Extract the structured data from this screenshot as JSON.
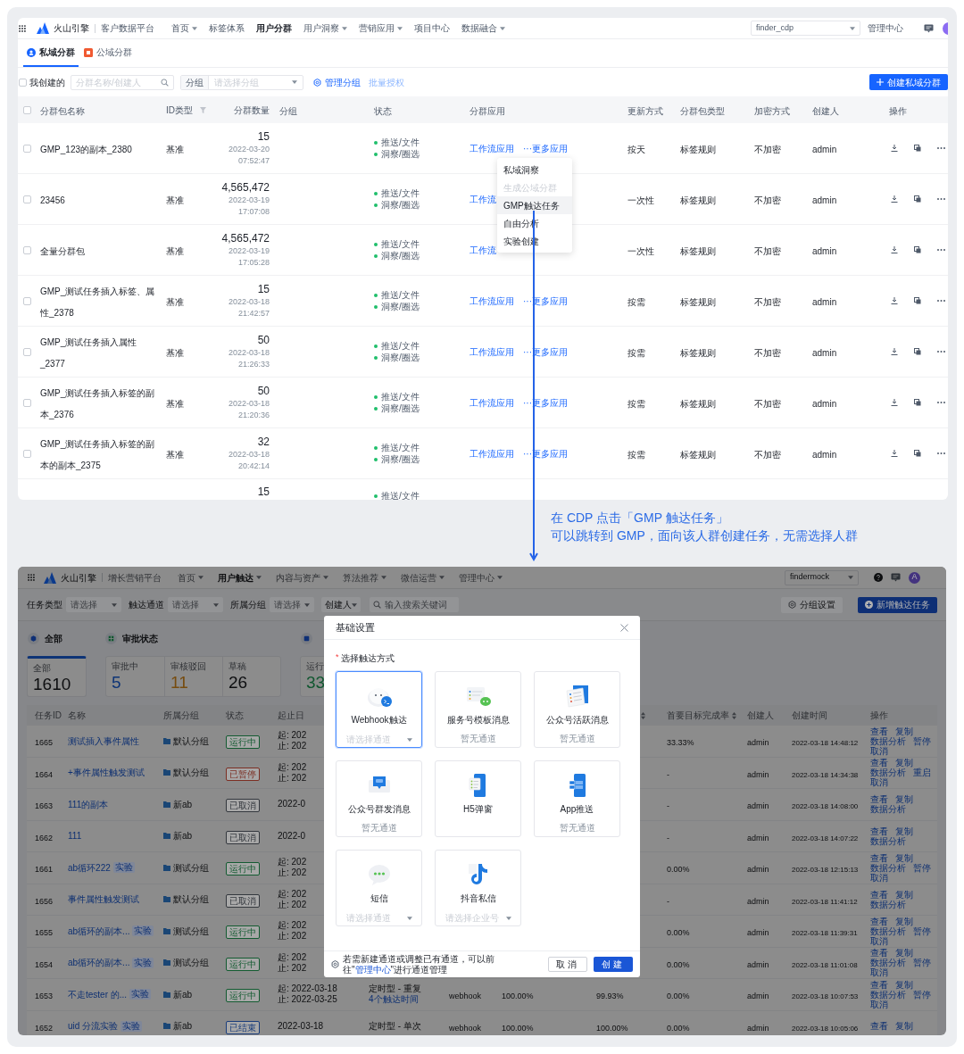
{
  "cdp_screen": {
    "brand": {
      "name": "火山引擎",
      "product": "客户数据平台"
    },
    "nav": [
      {
        "label": "首页",
        "dropdown": true,
        "selected": false
      },
      {
        "label": "标签体系",
        "dropdown": false,
        "selected": false
      },
      {
        "label": "用户分群",
        "dropdown": false,
        "selected": true
      },
      {
        "label": "用户洞察",
        "dropdown": true,
        "selected": false
      },
      {
        "label": "营销应用",
        "dropdown": true,
        "selected": false
      },
      {
        "label": "项目中心",
        "dropdown": false,
        "selected": false
      },
      {
        "label": "数据融合",
        "dropdown": true,
        "selected": false
      }
    ],
    "project": "finder_cdp",
    "admin_link": "管理中心",
    "tabs": [
      {
        "label": "私域分群",
        "selected": true
      },
      {
        "label": "公域分群",
        "selected": false
      }
    ],
    "mine_filter": {
      "label": "我创建的",
      "checked": false
    },
    "search": {
      "placeholder": "分群名称/创建人"
    },
    "group_filter": {
      "label": "分组",
      "placeholder": "请选择分组"
    },
    "manage_groups": "管理分组",
    "batch_authorize": "批量授权",
    "create_button": "创建私域分群",
    "table": {
      "select_all": {
        "checked": false
      },
      "columns": [
        "分群包名称",
        "ID类型",
        "分群数量",
        "分组",
        "状态",
        "分群应用",
        "更新方式",
        "分群包类型",
        "加密方式",
        "创建人",
        "操作"
      ],
      "rows": [
        {
          "checked": false,
          "name": "GMP_123的副本_2380",
          "id_type": "基准",
          "count": "15",
          "date": "2022-03-20",
          "time": "07:52:47",
          "states": [
            "推送/文件",
            "洞察/圈选"
          ],
          "apps": [
            "工作流应用",
            "···更多应用"
          ],
          "update": "按天",
          "type": "标签规则",
          "encryption": "不加密",
          "creator": "admin"
        },
        {
          "checked": false,
          "name": "23456",
          "id_type": "基准",
          "count": "4,565,472",
          "date": "2022-03-19",
          "time": "17:07:08",
          "states": [
            "推送/文件",
            "洞察/圈选"
          ],
          "apps": [
            "工作流"
          ],
          "update": "一次性",
          "type": "标签规则",
          "encryption": "不加密",
          "creator": "admin"
        },
        {
          "checked": false,
          "name": "全量分群包",
          "id_type": "基准",
          "count": "4,565,472",
          "date": "2022-03-19",
          "time": "17:05:28",
          "states": [
            "推送/文件",
            "洞察/圈选"
          ],
          "apps": [
            "工作流"
          ],
          "update": "一次性",
          "type": "标签规则",
          "encryption": "不加密",
          "creator": "admin"
        },
        {
          "checked": false,
          "name": "GMP_测试任务插入标签、属性_2378",
          "id_type": "基准",
          "count": "15",
          "date": "2022-03-18",
          "time": "21:42:57",
          "states": [
            "推送/文件",
            "洞察/圈选"
          ],
          "apps": [
            "工作流应用",
            "···更多应用"
          ],
          "update": "按需",
          "type": "标签规则",
          "encryption": "不加密",
          "creator": "admin"
        },
        {
          "checked": false,
          "name": "GMP_测试任务插入属性_2377",
          "id_type": "基准",
          "count": "50",
          "date": "2022-03-18",
          "time": "21:26:33",
          "states": [
            "推送/文件",
            "洞察/圈选"
          ],
          "apps": [
            "工作流应用",
            "···更多应用"
          ],
          "update": "按需",
          "type": "标签规则",
          "encryption": "不加密",
          "creator": "admin"
        },
        {
          "checked": false,
          "name": "GMP_测试任务插入标签的副本_2376",
          "id_type": "基准",
          "count": "50",
          "date": "2022-03-18",
          "time": "21:20:36",
          "states": [
            "推送/文件",
            "洞察/圈选"
          ],
          "apps": [
            "工作流应用",
            "···更多应用"
          ],
          "update": "按需",
          "type": "标签规则",
          "encryption": "不加密",
          "creator": "admin"
        },
        {
          "checked": false,
          "name": "GMP_测试任务插入标签的副本的副本_2375",
          "id_type": "基准",
          "count": "32",
          "date": "2022-03-18",
          "time": "20:42:14",
          "states": [
            "推送/文件",
            "洞察/圈选"
          ],
          "apps": [
            "工作流应用",
            "···更多应用"
          ],
          "update": "按需",
          "type": "标签规则",
          "encryption": "不加密",
          "creator": "admin"
        },
        {
          "count": "15",
          "states": [
            "推送/文件"
          ]
        }
      ]
    },
    "more_menu": [
      {
        "label": "私域洞察",
        "disabled": false,
        "selected": false
      },
      {
        "label": "生成公域分群",
        "disabled": true,
        "selected": false
      },
      {
        "label": "GMP触达任务",
        "disabled": false,
        "selected": true
      },
      {
        "label": "自由分析",
        "disabled": false,
        "selected": false
      },
      {
        "label": "实验创建",
        "disabled": false,
        "selected": false
      }
    ]
  },
  "annotation": [
    "在 CDP 点击「GMP 触达任务」",
    "可以跳转到 GMP，面向该人群创建任务，无需选择人群"
  ],
  "gmp_screen": {
    "brand": {
      "name": "火山引擎",
      "product": "增长营销平台"
    },
    "nav": [
      {
        "label": "首页",
        "dropdown": true,
        "selected": false
      },
      {
        "label": "用户触达",
        "dropdown": true,
        "selected": true
      },
      {
        "label": "内容与资产",
        "dropdown": true,
        "selected": false
      },
      {
        "label": "算法推荐",
        "dropdown": true,
        "selected": false
      },
      {
        "label": "微信运营",
        "dropdown": true,
        "selected": false
      },
      {
        "label": "管理中心",
        "dropdown": true,
        "selected": false
      }
    ],
    "project": "findermock",
    "avatar": "A",
    "filters": [
      {
        "label": "任务类型",
        "placeholder": "请选择"
      },
      {
        "label": "触达通道",
        "placeholder": "请选择"
      },
      {
        "label": "所属分组",
        "placeholder": "请选择"
      }
    ],
    "creator_filter": "创建人",
    "search": {
      "placeholder": "输入搜索关键词"
    },
    "group_settings": "分组设置",
    "create_button": "新增触达任务",
    "categories": [
      "全部",
      "审批状态"
    ],
    "stat_groups": [
      {
        "selected": true,
        "items": [
          {
            "label": "全部",
            "value": "1610",
            "color": "#0d0e10"
          }
        ]
      },
      {
        "selected": false,
        "items": [
          {
            "label": "审批中",
            "value": "5",
            "color": "#0e3476"
          },
          {
            "label": "审核驳回",
            "value": "11",
            "color": "#774c0f"
          },
          {
            "label": "草稿",
            "value": "26",
            "color": "#0d0e10"
          }
        ]
      },
      {
        "selected": false,
        "items": [
          {
            "label": "运行",
            "value": "33",
            "color": "#115730"
          }
        ]
      }
    ],
    "table": {
      "columns": [
        {
          "label": "任务ID"
        },
        {
          "label": "名称"
        },
        {
          "label": "所属分组"
        },
        {
          "label": "状态"
        },
        {
          "label": "起止日"
        },
        {
          "sortable": true
        },
        {
          "label": "首要目标完成率",
          "sortable": true
        },
        {
          "label": "创建人"
        },
        {
          "label": "创建时间"
        },
        {
          "label": "操作"
        }
      ],
      "rows": [
        {
          "id": "1665",
          "name": "测试插入事件属性",
          "group": "默认分组",
          "status": {
            "label": "运行中",
            "color": "#135b31"
          },
          "dates": [
            "起: 202",
            "止: 202"
          ],
          "goal_rate": "33.33%",
          "creator": "admin",
          "created": "2022-03-18 14:48:12",
          "actions": [
            "查看",
            "复制",
            "数据分析",
            "暂停",
            "取消"
          ]
        },
        {
          "id": "1664",
          "name": "+事件属性触发测试",
          "group": "默认分组",
          "status": {
            "label": "已暂停",
            "color": "#7b2e23"
          },
          "dates": [
            "起: 202",
            "止: 202"
          ],
          "goal_rate": "-",
          "creator": "admin",
          "created": "2022-03-18 14:34:38",
          "actions": [
            "查看",
            "复制",
            "数据分析",
            "重启",
            "取消"
          ]
        },
        {
          "id": "1663",
          "name": "111的副本",
          "group": "新ab",
          "status": {
            "label": "已取消",
            "color": "#33373d"
          },
          "dates": [
            "2022-0"
          ],
          "goal_rate": "-",
          "creator": "admin",
          "created": "2022-03-18 14:08:00",
          "actions": [
            "查看",
            "复制",
            "数据分析"
          ]
        },
        {
          "id": "1662",
          "name": "111",
          "group": "新ab",
          "status": {
            "label": "已取消",
            "color": "#33373d"
          },
          "dates": [
            "2022-0"
          ],
          "goal_rate": "-",
          "creator": "admin",
          "created": "2022-03-18 14:07:22",
          "actions": [
            "查看",
            "复制",
            "数据分析"
          ]
        },
        {
          "id": "1661",
          "name": "ab循环222",
          "badge": "实验",
          "group": "测试分组",
          "status": {
            "label": "运行中",
            "color": "#135b31"
          },
          "dates": [
            "起: 202",
            "止: 202"
          ],
          "goal_rate": "0.00%",
          "creator": "admin",
          "created": "2022-03-18 12:15:13",
          "actions": [
            "查看",
            "复制",
            "数据分析",
            "暂停",
            "取消"
          ]
        },
        {
          "id": "1656",
          "name": "事件属性触发测试",
          "group": "默认分组",
          "status": {
            "label": "已取消",
            "color": "#33373d"
          },
          "dates": [
            "起: 202",
            "止: 202"
          ],
          "goal_rate": "-",
          "creator": "admin",
          "created": "2022-03-18 11:41:12",
          "actions": [
            "查看",
            "复制",
            "数据分析"
          ]
        },
        {
          "id": "1655",
          "name": "ab循环的副本...",
          "badge": "实验",
          "group": "测试分组",
          "status": {
            "label": "运行中",
            "color": "#135b31"
          },
          "dates": [
            "起: 202",
            "止: 202"
          ],
          "goal_rate": "0.00%",
          "creator": "admin",
          "created": "2022-03-18 11:39:31",
          "actions": [
            "查看",
            "复制",
            "数据分析",
            "暂停",
            "取消"
          ]
        },
        {
          "id": "1654",
          "name": "ab循环的副本...",
          "badge": "实验",
          "group": "测试分组",
          "status": {
            "label": "运行中",
            "color": "#135b31"
          },
          "dates": [
            "起: 202",
            "止: 202"
          ],
          "goal_rate": "0.00%",
          "creator": "admin",
          "created": "2022-03-18 11:01:08",
          "actions": [
            "查看",
            "复制",
            "数据分析",
            "暂停",
            "取消"
          ]
        },
        {
          "id": "1653",
          "name": "不走tester 的...",
          "badge": "实验",
          "group": "新ab",
          "status": {
            "label": "运行中",
            "color": "#135b31"
          },
          "dates": [
            "起: 2022-03-18",
            "止: 2022-03-25"
          ],
          "schedule": [
            {
              "text": "定时型 - 重复",
              "kind": "plain"
            },
            {
              "text": "4个触达时间",
              "kind": "link"
            }
          ],
          "channel": "webhook",
          "metric_1": "100.00%",
          "metric_2": "99.93%",
          "goal_rate": "0.00%",
          "creator": "admin",
          "created": "2022-03-18 10:07:53",
          "actions": [
            "查看",
            "复制",
            "数据分析",
            "暂停",
            "取消"
          ]
        },
        {
          "id": "1652",
          "name": "uid 分流实验",
          "badge": "实验",
          "group": "新ab",
          "status": {
            "label": "已结束",
            "color": "#1a3d7b"
          },
          "dates": [
            "2022-03-18"
          ],
          "schedule": [
            {
              "text": "定时型 - 单次",
              "kind": "plain"
            }
          ],
          "channel": "webhook",
          "metric_1": "100.00%",
          "metric_2": "100.00%",
          "goal_rate": "0.00%",
          "creator": "admin",
          "created": "2022-03-18 10:05:06",
          "actions": [
            "查看",
            "复制"
          ]
        }
      ]
    },
    "modal": {
      "title": "基础设置",
      "required_mark": "*",
      "label": "选择触达方式",
      "channels": [
        {
          "name": "Webhook触达",
          "kind": "select",
          "placeholder": "请选择通道",
          "selected": true
        },
        {
          "name": "服务号模板消息",
          "kind": "note",
          "note": "暂无通道",
          "selected": false
        },
        {
          "name": "公众号活跃消息",
          "kind": "note",
          "note": "暂无通道",
          "selected": false
        },
        {
          "name": "公众号群发消息",
          "kind": "note",
          "note": "暂无通道",
          "selected": false
        },
        {
          "name": "H5弹窗",
          "kind": "plain",
          "selected": false
        },
        {
          "name": "App推送",
          "kind": "note",
          "note": "暂无通道",
          "selected": false
        },
        {
          "name": "短信",
          "kind": "select",
          "placeholder": "请选择通道",
          "selected": false
        },
        {
          "name": "抖音私信",
          "kind": "select",
          "placeholder": "请选择企业号",
          "selected": false
        }
      ],
      "footer_note": {
        "before": "若需新建通道或调整已有通道，可以前往\"",
        "link": "管理中心",
        "after": "\"进行通道管理"
      },
      "cancel": "取消",
      "confirm": "创建"
    }
  }
}
